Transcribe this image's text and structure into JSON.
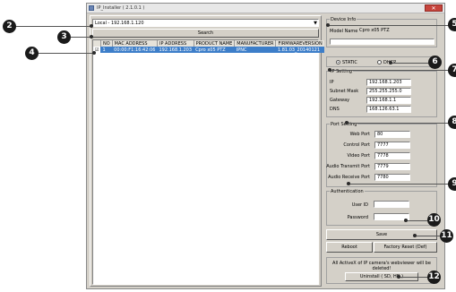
{
  "window": {
    "title": "IP_Installer ( 2.1.0.1 )",
    "close_glyph": "✕"
  },
  "adapter": {
    "value": "Local - 192.168.1.120",
    "arrow": "▼"
  },
  "search_label": "Search",
  "table": {
    "headers": [
      "NO",
      "MAC ADDRESS",
      "IP ADDRESS",
      "PRODUCT NAME",
      "MANUFACTURER",
      "FIRMWAREVERSION"
    ],
    "rows": [
      {
        "check": "☑",
        "no": "1",
        "mac": "00:00:F1:16:42:06",
        "ip": "192.168.1.203",
        "product": "Cpro x05 PTZ",
        "manufacturer": "IPNC",
        "firmware": "1.81.03_20140121"
      }
    ],
    "selected_color": "#3d7ec9"
  },
  "device_info": {
    "group": "Device Info",
    "model_label": "Model Name",
    "model_value": "Cpro x05 PTZ"
  },
  "ip_mode": {
    "static": "STATIC",
    "dhcp": "DHCP",
    "selected": "STATIC"
  },
  "ip_setting": {
    "group": "IP Setting",
    "fields": [
      {
        "label": "IP",
        "value": "192.168.1.203"
      },
      {
        "label": "Subnet Mask",
        "value": "255.255.255.0"
      },
      {
        "label": "Gateway",
        "value": "192.168.1.1"
      },
      {
        "label": "DNS",
        "value": "168.126.63.1"
      }
    ]
  },
  "port_setting": {
    "group": "Port Setting",
    "fields": [
      {
        "label": "Web Port",
        "value": "80"
      },
      {
        "label": "Control Port",
        "value": "7777"
      },
      {
        "label": "Video Port",
        "value": "7778"
      },
      {
        "label": "Audio Transmit Port",
        "value": "7779"
      },
      {
        "label": "Audio Receive Port",
        "value": "7780"
      }
    ]
  },
  "authentication": {
    "group": "Authentication",
    "user_label": "User ID",
    "password_label": "Password",
    "user_value": "",
    "password_value": ""
  },
  "buttons": {
    "save": "Save",
    "reboot": "Reboot",
    "factory_reset": "Factory Reset (Def)",
    "uninstall": "Uninstall ( SD, HD )"
  },
  "uninstall_warning": "All ActiveX of IP camera's webviewer will be deleted!",
  "callouts": [
    "2",
    "3",
    "4",
    "5",
    "6",
    "7",
    "8",
    "9",
    "10",
    "11",
    "12"
  ]
}
